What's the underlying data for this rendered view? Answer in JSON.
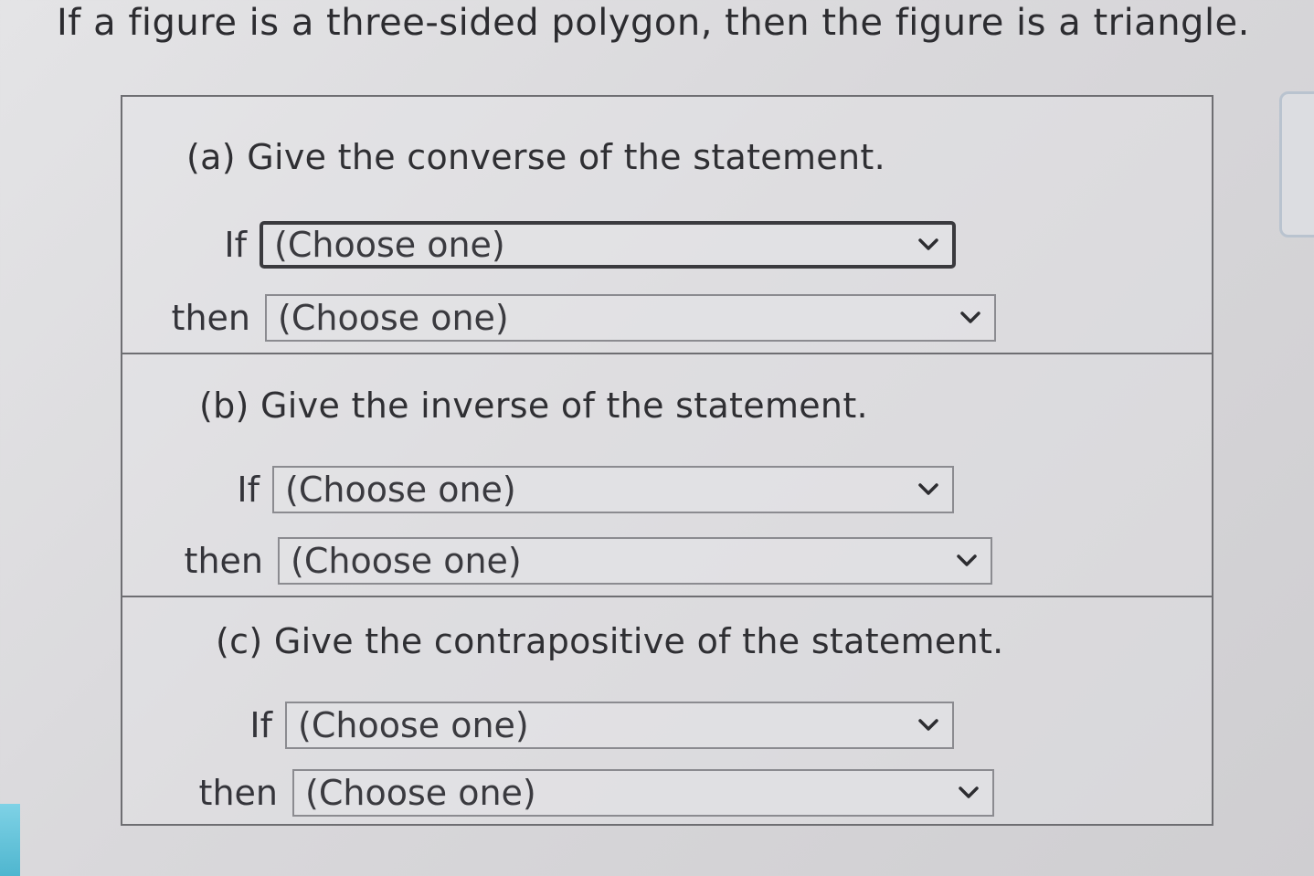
{
  "statement": "If a figure is a three-sided polygon, then the figure is a triangle.",
  "sections": [
    {
      "question": "(a) Give the converse of the statement.",
      "if_label": "If",
      "then_label": "then",
      "if_select": "(Choose one)",
      "then_select": "(Choose one)"
    },
    {
      "question": "(b) Give the inverse of the statement.",
      "if_label": "If",
      "then_label": "then",
      "if_select": "(Choose one)",
      "then_select": "(Choose one)"
    },
    {
      "question": "(c) Give the contrapositive of the statement.",
      "if_label": "If",
      "then_label": "then",
      "if_select": "(Choose one)",
      "then_select": "(Choose one)"
    }
  ],
  "icons": {
    "dropdown": "chevron-down-icon"
  },
  "colors": {
    "border": "#6e6e72",
    "text": "#2f2f33",
    "focus_border": "#3a3a3e"
  }
}
